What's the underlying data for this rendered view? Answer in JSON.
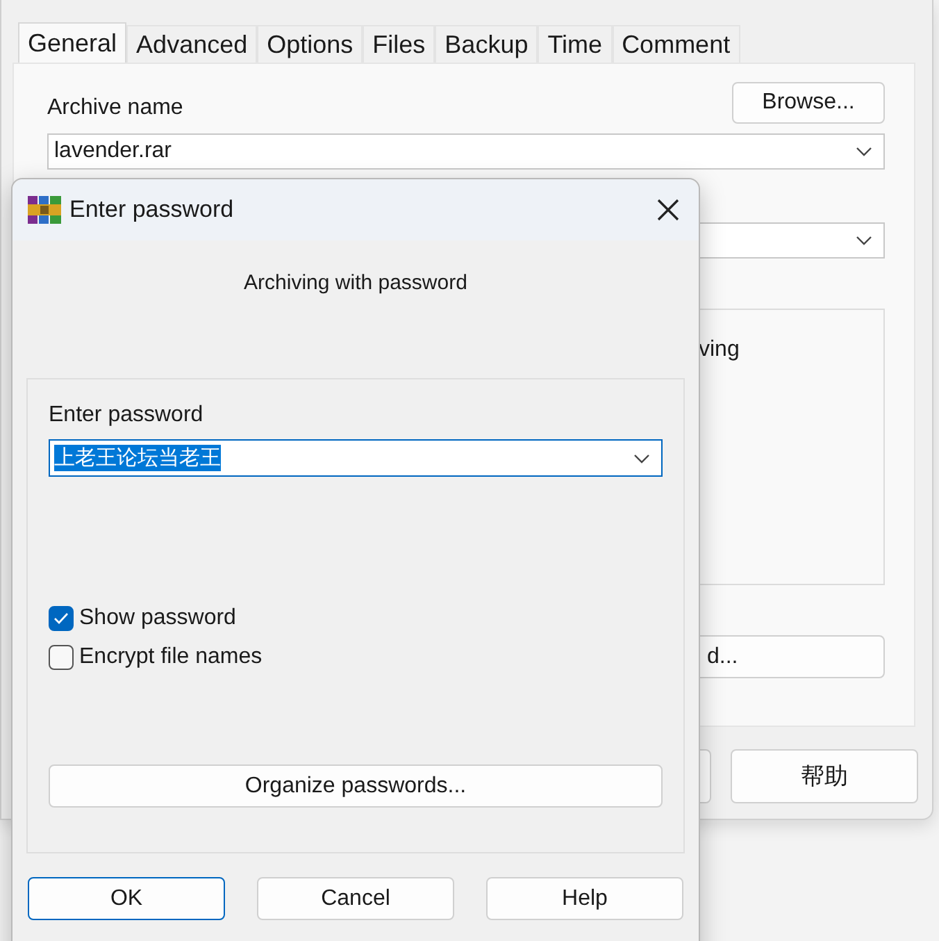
{
  "main_window": {
    "tabs": [
      {
        "label": "General",
        "selected": true
      },
      {
        "label": "Advanced",
        "selected": false
      },
      {
        "label": "Options",
        "selected": false
      },
      {
        "label": "Files",
        "selected": false
      },
      {
        "label": "Backup",
        "selected": false
      },
      {
        "label": "Time",
        "selected": false
      },
      {
        "label": "Comment",
        "selected": false
      }
    ],
    "archive_name_label": "Archive name",
    "browse_button": "Browse...",
    "archive_name": "lavender.rar",
    "group_text": "ving",
    "partial_button": "d...",
    "help_button": "帮助"
  },
  "dialog": {
    "title": "Enter password",
    "subtitle": "Archiving with password",
    "password_label": "Enter password",
    "password_value": "上老王论坛当老王",
    "options": [
      {
        "label": "Show password",
        "checked": true
      },
      {
        "label": "Encrypt file names",
        "checked": false
      }
    ],
    "organize_button": "Organize passwords...",
    "buttons": [
      {
        "label": "OK",
        "default": true
      },
      {
        "label": "Cancel",
        "default": false
      },
      {
        "label": "Help",
        "default": false
      }
    ]
  }
}
